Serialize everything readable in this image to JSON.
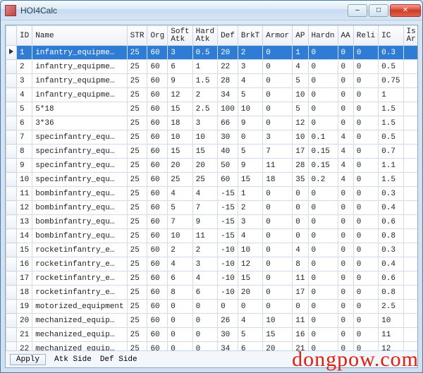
{
  "window": {
    "title": "HOI4Calc"
  },
  "win_buttons": {
    "min": "–",
    "max": "□",
    "close": "✕"
  },
  "columns": [
    {
      "key": "rowhdr",
      "label": ""
    },
    {
      "key": "id",
      "label": "ID"
    },
    {
      "key": "name",
      "label": "Name"
    },
    {
      "key": "str",
      "label": "STR"
    },
    {
      "key": "org",
      "label": "Org"
    },
    {
      "key": "softatk",
      "label": "Soft\nAtk"
    },
    {
      "key": "hardatk",
      "label": "Hard\nAtk"
    },
    {
      "key": "def",
      "label": "Def"
    },
    {
      "key": "brkt",
      "label": "BrkT"
    },
    {
      "key": "armor",
      "label": "Armor"
    },
    {
      "key": "ap",
      "label": "AP"
    },
    {
      "key": "hardn",
      "label": "Hardn"
    },
    {
      "key": "aa",
      "label": "AA"
    },
    {
      "key": "reli",
      "label": "Reli"
    },
    {
      "key": "ic",
      "label": "IC"
    },
    {
      "key": "isar",
      "label": "Is\nAr"
    }
  ],
  "rows": [
    {
      "id": "1",
      "name": "infantry_equipme…",
      "str": "25",
      "org": "60",
      "softatk": "3",
      "hardatk": "0.5",
      "def": "20",
      "brkt": "2",
      "armor": "0",
      "ap": "1",
      "hardn": "0",
      "aa": "0",
      "reli": "0",
      "ic": "0.3",
      "selected": true
    },
    {
      "id": "2",
      "name": "infantry_equipme…",
      "str": "25",
      "org": "60",
      "softatk": "6",
      "hardatk": "1",
      "def": "22",
      "brkt": "3",
      "armor": "0",
      "ap": "4",
      "hardn": "0",
      "aa": "0",
      "reli": "0",
      "ic": "0.5"
    },
    {
      "id": "3",
      "name": "infantry_equipme…",
      "str": "25",
      "org": "60",
      "softatk": "9",
      "hardatk": "1.5",
      "def": "28",
      "brkt": "4",
      "armor": "0",
      "ap": "5",
      "hardn": "0",
      "aa": "0",
      "reli": "0",
      "ic": "0.75"
    },
    {
      "id": "4",
      "name": "infantry_equipme…",
      "str": "25",
      "org": "60",
      "softatk": "12",
      "hardatk": "2",
      "def": "34",
      "brkt": "5",
      "armor": "0",
      "ap": "10",
      "hardn": "0",
      "aa": "0",
      "reli": "0",
      "ic": "1"
    },
    {
      "id": "5",
      "name": "5*18",
      "str": "25",
      "org": "60",
      "softatk": "15",
      "hardatk": "2.5",
      "def": "100",
      "brkt": "10",
      "armor": "0",
      "ap": "5",
      "hardn": "0",
      "aa": "0",
      "reli": "0",
      "ic": "1.5"
    },
    {
      "id": "6",
      "name": "3*36",
      "str": "25",
      "org": "60",
      "softatk": "18",
      "hardatk": "3",
      "def": "66",
      "brkt": "9",
      "armor": "0",
      "ap": "12",
      "hardn": "0",
      "aa": "0",
      "reli": "0",
      "ic": "1.5"
    },
    {
      "id": "7",
      "name": "specinfantry_equ…",
      "str": "25",
      "org": "60",
      "softatk": "10",
      "hardatk": "10",
      "def": "30",
      "brkt": "0",
      "armor": "3",
      "ap": "10",
      "hardn": "0.1",
      "aa": "4",
      "reli": "0",
      "ic": "0.5"
    },
    {
      "id": "8",
      "name": "specinfantry_equ…",
      "str": "25",
      "org": "60",
      "softatk": "15",
      "hardatk": "15",
      "def": "40",
      "brkt": "5",
      "armor": "7",
      "ap": "17",
      "hardn": "0.15",
      "aa": "4",
      "reli": "0",
      "ic": "0.7"
    },
    {
      "id": "9",
      "name": "specinfantry_equ…",
      "str": "25",
      "org": "60",
      "softatk": "20",
      "hardatk": "20",
      "def": "50",
      "brkt": "9",
      "armor": "11",
      "ap": "28",
      "hardn": "0.15",
      "aa": "4",
      "reli": "0",
      "ic": "1.1"
    },
    {
      "id": "10",
      "name": "specinfantry_equ…",
      "str": "25",
      "org": "60",
      "softatk": "25",
      "hardatk": "25",
      "def": "60",
      "brkt": "15",
      "armor": "18",
      "ap": "35",
      "hardn": "0.2",
      "aa": "4",
      "reli": "0",
      "ic": "1.5"
    },
    {
      "id": "11",
      "name": "bombinfantry_equ…",
      "str": "25",
      "org": "60",
      "softatk": "4",
      "hardatk": "4",
      "def": "-15",
      "brkt": "1",
      "armor": "0",
      "ap": "0",
      "hardn": "0",
      "aa": "0",
      "reli": "0",
      "ic": "0.3"
    },
    {
      "id": "12",
      "name": "bombinfantry_equ…",
      "str": "25",
      "org": "60",
      "softatk": "5",
      "hardatk": "7",
      "def": "-15",
      "brkt": "2",
      "armor": "0",
      "ap": "0",
      "hardn": "0",
      "aa": "0",
      "reli": "0",
      "ic": "0.4"
    },
    {
      "id": "13",
      "name": "bombinfantry_equ…",
      "str": "25",
      "org": "60",
      "softatk": "7",
      "hardatk": "9",
      "def": "-15",
      "brkt": "3",
      "armor": "0",
      "ap": "0",
      "hardn": "0",
      "aa": "0",
      "reli": "0",
      "ic": "0.6"
    },
    {
      "id": "14",
      "name": "bombinfantry_equ…",
      "str": "25",
      "org": "60",
      "softatk": "10",
      "hardatk": "11",
      "def": "-15",
      "brkt": "4",
      "armor": "0",
      "ap": "0",
      "hardn": "0",
      "aa": "0",
      "reli": "0",
      "ic": "0.8"
    },
    {
      "id": "15",
      "name": "rocketinfantry_e…",
      "str": "25",
      "org": "60",
      "softatk": "2",
      "hardatk": "2",
      "def": "-10",
      "brkt": "10",
      "armor": "0",
      "ap": "4",
      "hardn": "0",
      "aa": "0",
      "reli": "0",
      "ic": "0.3"
    },
    {
      "id": "16",
      "name": "rocketinfantry_e…",
      "str": "25",
      "org": "60",
      "softatk": "4",
      "hardatk": "3",
      "def": "-10",
      "brkt": "12",
      "armor": "0",
      "ap": "8",
      "hardn": "0",
      "aa": "0",
      "reli": "0",
      "ic": "0.4"
    },
    {
      "id": "17",
      "name": "rocketinfantry_e…",
      "str": "25",
      "org": "60",
      "softatk": "6",
      "hardatk": "4",
      "def": "-10",
      "brkt": "15",
      "armor": "0",
      "ap": "11",
      "hardn": "0",
      "aa": "0",
      "reli": "0",
      "ic": "0.6"
    },
    {
      "id": "18",
      "name": "rocketinfantry_e…",
      "str": "25",
      "org": "60",
      "softatk": "8",
      "hardatk": "6",
      "def": "-10",
      "brkt": "20",
      "armor": "0",
      "ap": "17",
      "hardn": "0",
      "aa": "0",
      "reli": "0",
      "ic": "0.8"
    },
    {
      "id": "19",
      "name": "motorized_equipment",
      "str": "25",
      "org": "60",
      "softatk": "0",
      "hardatk": "0",
      "def": "0",
      "brkt": "0",
      "armor": "0",
      "ap": "0",
      "hardn": "0",
      "aa": "0",
      "reli": "0",
      "ic": "2.5"
    },
    {
      "id": "20",
      "name": "mechanized_equip…",
      "str": "25",
      "org": "60",
      "softatk": "0",
      "hardatk": "0",
      "def": "26",
      "brkt": "4",
      "armor": "10",
      "ap": "11",
      "hardn": "0",
      "aa": "0",
      "reli": "0",
      "ic": "10"
    },
    {
      "id": "21",
      "name": "mechanized_equip…",
      "str": "25",
      "org": "60",
      "softatk": "0",
      "hardatk": "0",
      "def": "30",
      "brkt": "5",
      "armor": "15",
      "ap": "16",
      "hardn": "0",
      "aa": "0",
      "reli": "0",
      "ic": "11"
    },
    {
      "id": "22",
      "name": "mechanized_equip…",
      "str": "25",
      "org": "60",
      "softatk": "0",
      "hardatk": "0",
      "def": "34",
      "brkt": "6",
      "armor": "20",
      "ap": "21",
      "hardn": "0",
      "aa": "0",
      "reli": "0",
      "ic": "12"
    }
  ],
  "footer": {
    "apply": "Apply",
    "atk_side": "Atk Side",
    "def_side": "Def Side"
  },
  "watermark": "dongpow.com"
}
